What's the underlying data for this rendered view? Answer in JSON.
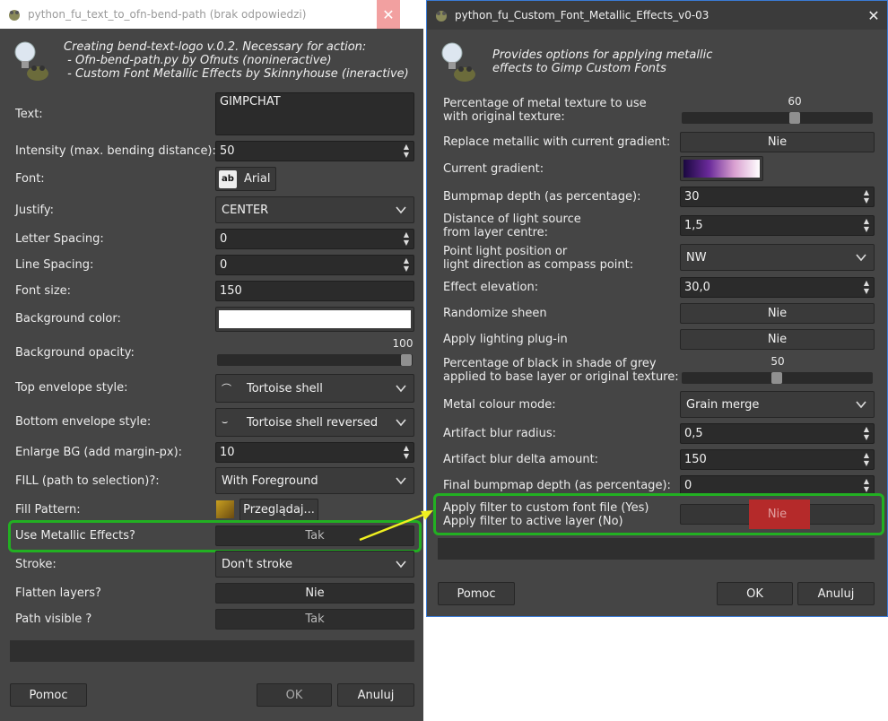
{
  "left_window": {
    "title": "python_fu_text_to_ofn-bend-path (brak odpowiedzi)",
    "header": "Creating bend-text-logo v.0.2. Necessary for action:\n - Ofn-bend-path.py by Ofnuts (nonineractive)\n - Custom Font Metallic Effects by Skinnyhouse (ineractive)",
    "fields": {
      "text_label": "Text:",
      "text_value": "GIMPCHAT",
      "intensity_label": "Intensity (max. bending distance):",
      "intensity_value": "50",
      "font_label": "Font:",
      "font_value": "Arial",
      "font_icon_text": "ab",
      "justify_label": "Justify:",
      "justify_value": "CENTER",
      "letter_spacing_label": "Letter Spacing:",
      "letter_spacing_value": "0",
      "line_spacing_label": "Line Spacing:",
      "line_spacing_value": "0",
      "font_size_label": "Font size:",
      "font_size_value": "150",
      "bg_color_label": "Background color:",
      "bg_opacity_label": "Background opacity:",
      "bg_opacity_value": "100",
      "top_env_label": "Top envelope style:",
      "top_env_value": "Tortoise shell",
      "bottom_env_label": "Bottom envelope style:",
      "bottom_env_value": "Tortoise shell reversed",
      "enlarge_label": "Enlarge BG (add margin-px):",
      "enlarge_value": "10",
      "fill_label": "FILL (path to selection)?:",
      "fill_value": "With Foreground",
      "fill_pattern_label": "Fill Pattern:",
      "fill_pattern_button": "Przeglądaj...",
      "metallic_label": "Use Metallic Effects?",
      "metallic_value": "Tak",
      "stroke_label": "Stroke:",
      "stroke_value": "Don't stroke",
      "flatten_label": "Flatten layers?",
      "flatten_value": "Nie",
      "path_visible_label": "Path visible ?",
      "path_visible_value": "Tak"
    },
    "buttons": {
      "help": "Pomoc",
      "ok": "OK",
      "cancel": "Anuluj"
    }
  },
  "right_window": {
    "title": "python_fu_Custom_Font_Metallic_Effects_v0-03",
    "header": "Provides options for applying metallic\neffects to Gimp Custom Fonts",
    "fields": {
      "metal_pct_label": "Percentage of metal texture to use\nwith original texture:",
      "metal_pct_value": "60",
      "replace_label": "Replace metallic with current gradient:",
      "replace_value": "Nie",
      "gradient_label": "Current gradient:",
      "bump_label": "Bumpmap depth (as percentage):",
      "bump_value": "30",
      "distance_label": "Distance of light source\nfrom layer centre:",
      "distance_value": "1,5",
      "point_label": "Point light position or\nlight direction as compass point:",
      "point_value": "NW",
      "elevation_label": "Effect elevation:",
      "elevation_value": "30,0",
      "randomize_label": "Randomize sheen",
      "randomize_value": "Nie",
      "apply_light_label": "Apply lighting plug-in",
      "apply_light_value": "Nie",
      "black_label": "Percentage of black in shade of grey\napplied to base layer or original texture:",
      "black_value": "50",
      "colour_mode_label": "Metal colour mode:",
      "colour_mode_value": "Grain merge",
      "blur_radius_label": "Artifact blur radius:",
      "blur_radius_value": "0,5",
      "blur_delta_label": "Artifact blur delta amount:",
      "blur_delta_value": "150",
      "final_bump_label": "Final bumpmap depth (as percentage):",
      "final_bump_value": "0",
      "apply_font_label": "Apply filter to custom font file (Yes)\nApply filter to active layer (No)",
      "apply_font_value": "Nie"
    },
    "buttons": {
      "help": "Pomoc",
      "ok": "OK",
      "cancel": "Anuluj"
    }
  },
  "colors": {
    "highlight": "#22b022",
    "annotation_arrow": "#f0f020",
    "nie_highlight": "#b52a2a",
    "window_bg": "#454545",
    "right_border": "#3a7bd5"
  }
}
